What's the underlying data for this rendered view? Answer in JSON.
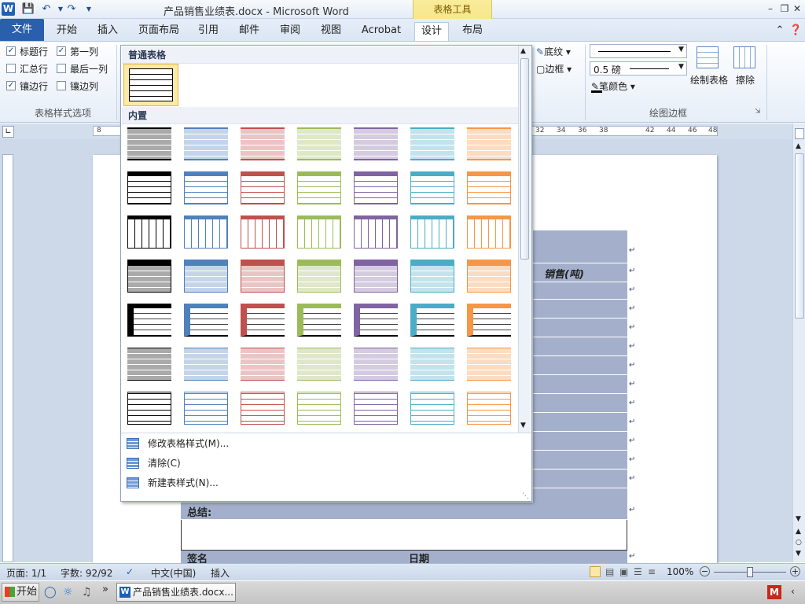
{
  "titlebar": {
    "app_icon": "word-icon",
    "title": "产品销售业绩表.docx - Microsoft Word",
    "context_tool": "表格工具"
  },
  "tabs": [
    "文件",
    "开始",
    "插入",
    "页面布局",
    "引用",
    "邮件",
    "审阅",
    "视图",
    "Acrobat",
    "设计",
    "布局"
  ],
  "active_tab": "设计",
  "style_options": {
    "checkboxes": [
      {
        "label": "标题行",
        "checked": true
      },
      {
        "label": "第一列",
        "checked": true
      },
      {
        "label": "汇总行",
        "checked": false
      },
      {
        "label": "最后一列",
        "checked": false
      },
      {
        "label": "镶边行",
        "checked": true
      },
      {
        "label": "镶边列",
        "checked": false
      }
    ],
    "group_label": "表格样式选项"
  },
  "borders": {
    "shading_label": "底纹",
    "border_label": "边框",
    "line_weight": "0.5 磅",
    "pen_color_label": "笔颜色",
    "draw_table_label": "绘制表格",
    "eraser_label": "擦除",
    "group_label": "绘图边框"
  },
  "ruler": {
    "ticks": [
      "8",
      "32",
      "34",
      "36",
      "38",
      "42",
      "44",
      "46",
      "48"
    ]
  },
  "gallery": {
    "section_plain": "普通表格",
    "section_builtin": "内置",
    "menu": [
      {
        "label": "修改表格样式(M)..."
      },
      {
        "label": "清除(C)"
      },
      {
        "label": "新建表样式(N)..."
      }
    ],
    "colors": [
      "#000000",
      "#4f81bd",
      "#c0504d",
      "#9bbb59",
      "#8064a2",
      "#4bacc6",
      "#f79646"
    ]
  },
  "document": {
    "header_cell": "销售(吨)",
    "summary_label": "总结:",
    "sign_label": "签名",
    "date_label": "日期",
    "para_mark": "↵"
  },
  "statusbar": {
    "page": "页面: 1/1",
    "words": "字数: 92/92",
    "language": "中文(中国)",
    "mode": "插入",
    "zoom": "100%"
  },
  "taskbar": {
    "start": "开始",
    "word_task": "产品销售业绩表.docx..."
  }
}
